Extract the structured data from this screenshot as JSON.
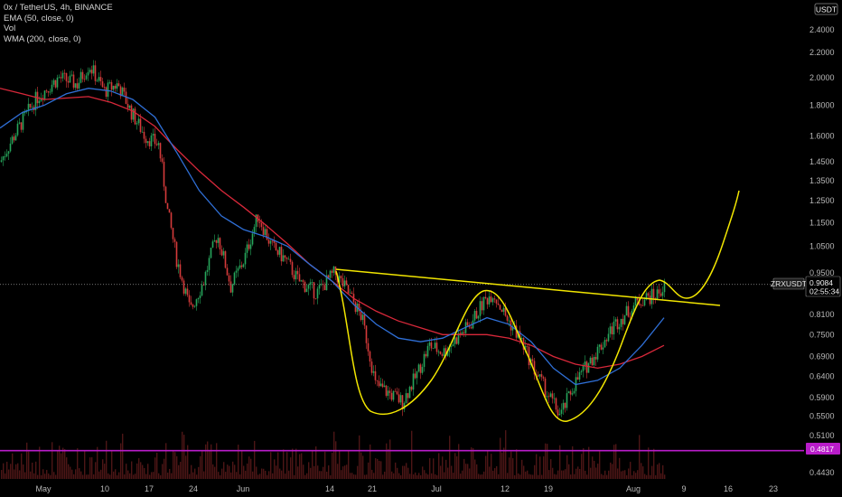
{
  "legend": {
    "symbol_line": "0x / TetherUS, 4h, BINANCE",
    "ema": "EMA (50, close, 0)",
    "vol": "Vol",
    "wma": "WMA (200, close, 0)"
  },
  "currency_badge": "USDT",
  "symbol_tag": "ZRXUSDT",
  "colors": {
    "background": "#000000",
    "up": "#26a65b",
    "down": "#d63a3a",
    "ema": "#2f6fd6",
    "wma": "#d8283a",
    "annotation": "#f2e600",
    "threshold": "#b81cc9",
    "volume": "#5a1a1a"
  },
  "chart_data": {
    "type": "candlestick",
    "timeframe": "4h",
    "x_ticks": [
      "May",
      "10",
      "17",
      "24",
      "Jun",
      "14",
      "21",
      "Jul",
      "12",
      "19",
      "Aug",
      "9",
      "16",
      "23"
    ],
    "y_ticks": [
      "2.4000",
      "2.2000",
      "2.0000",
      "1.8000",
      "1.6000",
      "1.4500",
      "1.3500",
      "1.2500",
      "1.1500",
      "1.0500",
      "0.9500",
      "0.8100",
      "0.7500",
      "0.6900",
      "0.6400",
      "0.5900",
      "0.5500",
      "0.5100",
      "0.4430"
    ],
    "y_scale": "log",
    "current_price": {
      "label": "ZRXUSDT",
      "value": "0.9084",
      "countdown": "02:55:34"
    },
    "horizontal_line": {
      "value": "0.4817"
    },
    "series": [
      {
        "name": "EMA (50, close, 0)",
        "kind": "line",
        "values": [
          1.65,
          1.75,
          1.8,
          1.88,
          1.92,
          1.9,
          1.84,
          1.72,
          1.5,
          1.3,
          1.18,
          1.12,
          1.09,
          1.05,
          0.98,
          0.92,
          0.84,
          0.78,
          0.74,
          0.73,
          0.74,
          0.77,
          0.8,
          0.78,
          0.73,
          0.66,
          0.62,
          0.63,
          0.66,
          0.72,
          0.8
        ]
      },
      {
        "name": "WMA (200, close, 0)",
        "kind": "line",
        "values": [
          1.92,
          1.88,
          1.84,
          1.85,
          1.86,
          1.82,
          1.76,
          1.66,
          1.52,
          1.4,
          1.3,
          1.22,
          1.14,
          1.06,
          0.98,
          0.92,
          0.86,
          0.82,
          0.79,
          0.77,
          0.75,
          0.75,
          0.75,
          0.74,
          0.72,
          0.69,
          0.67,
          0.66,
          0.67,
          0.69,
          0.72
        ]
      }
    ],
    "volume": "shown",
    "annotations": [
      "descending neckline",
      "double-bottom W curve",
      "projected breakout"
    ]
  }
}
